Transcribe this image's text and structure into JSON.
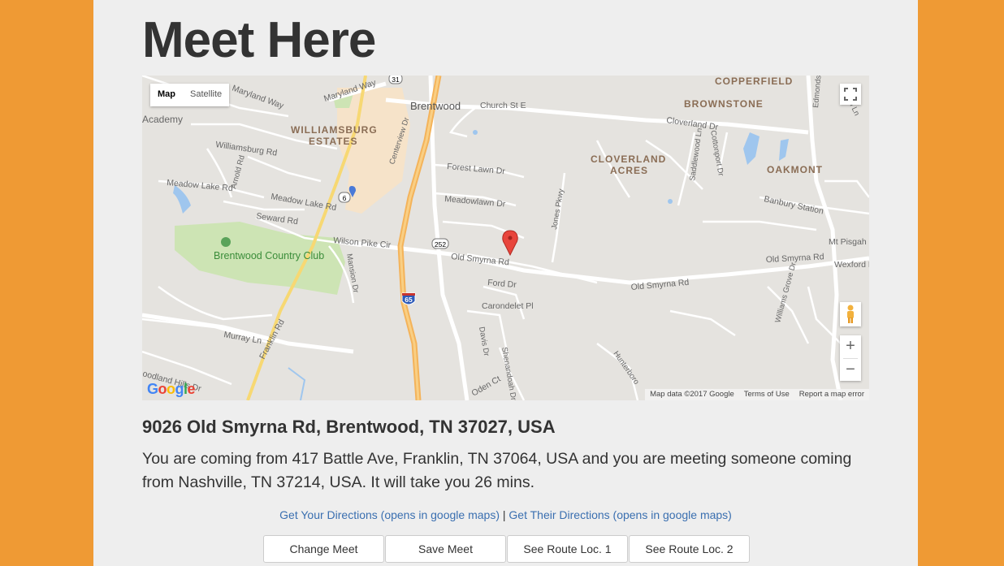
{
  "page": {
    "title": "Meet Here"
  },
  "map": {
    "type_map": "Map",
    "type_satellite": "Satellite",
    "attribution": "Map data ©2017 Google",
    "terms": "Terms of Use",
    "report": "Report a map error",
    "logo": "Google",
    "zoom_in": "+",
    "zoom_out": "−",
    "labels": {
      "academy": "Academy",
      "maryland_way": "Maryland Way",
      "maryland_way2": "Maryland Way",
      "brentwood": "Brentwood",
      "church_st": "Church St E",
      "copperfield": "COPPERFIELD",
      "brownstone": "BROWNSTONE",
      "cloverland_dr": "Cloverland Dr",
      "williamsburg_estates_1": "WILLIAMSBURG",
      "williamsburg_estates_2": "ESTATES",
      "williamsburg_rd": "Williamsburg Rd",
      "cloverland_acres_1": "CLOVERLAND",
      "cloverland_acres_2": "ACRES",
      "oakmont": "OAKMONT",
      "forest_lawn": "Forest Lawn Dr",
      "meadow_lake": "Meadow Lake Rd",
      "meadow_lake2": "Meadow Lake Rd",
      "meadowlawn": "Meadowlawn Dr",
      "seward": "Seward Rd",
      "banbury": "Banbury Station",
      "wilson_pike": "Wilson Pike Cir",
      "mt_pisgah": "Mt Pisgah",
      "old_smyrna_1": "Old Smyrna Rd",
      "old_smyrna_2": "Old Smyrna Rd",
      "old_smyrna_3": "Old Smyrna Rd",
      "wexford": "Wexford D",
      "country_club": "Brentwood Country Club",
      "ford_dr": "Ford Dr",
      "carondelet": "Carondelet Pl",
      "murray": "Murray Ln",
      "franklin_rd": "Franklin Rd",
      "woodland_hills": "oodland Hills Dr",
      "oden_ct": "Oden Ct",
      "route_31": "31",
      "route_252": "252",
      "route_6": "6",
      "route_65": "65",
      "jones_pkwy": "Jones Pkwy",
      "arnold_rd": "Arnold Rd",
      "mansion_dr": "Mansion Dr",
      "centerview": "Centerview Dr",
      "davis_dr": "Davis Dr",
      "shenandoah": "Shenandoah Dr",
      "hunterboro": "Hunterboro",
      "saddlewood": "Saddlewood Ln",
      "cottonport": "Cottonport Dr",
      "williams_grove": "Williams Grove Dr",
      "edmondson": "Edmondson",
      "frontier": "Fronti Ln"
    }
  },
  "result": {
    "address": "9026 Old Smyrna Rd, Brentwood, TN 37027, USA",
    "description": "You are coming from 417 Battle Ave, Franklin, TN 37064, USA and you are meeting someone coming from Nashville, TN 37214, USA. It will take you 26 mins."
  },
  "links": {
    "your_directions": "Get Your Directions (opens in google maps)",
    "separator": " | ",
    "their_directions": "Get Their Directions (opens in google maps)"
  },
  "buttons": {
    "change": "Change Meet",
    "save": "Save Meet",
    "route1": "See Route Loc. 1",
    "route2": "See Route Loc. 2"
  },
  "colors": {
    "background": "#ef9a34",
    "panel": "#eeeeee",
    "link": "#3a6fb0",
    "marker": "#e8453c"
  }
}
